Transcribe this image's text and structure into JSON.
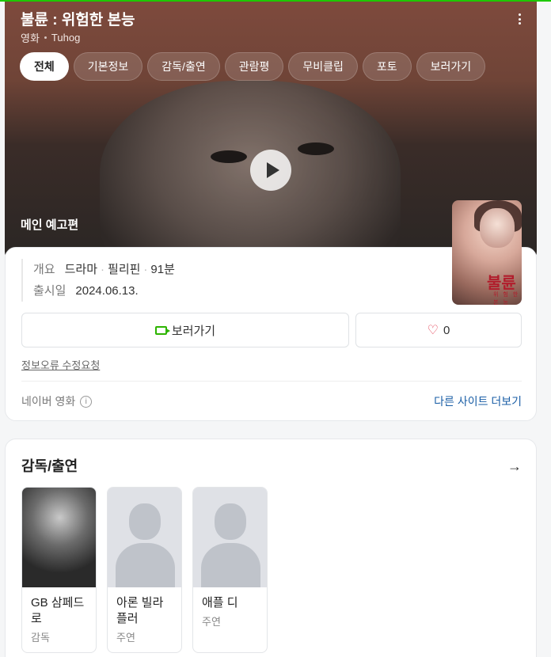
{
  "header": {
    "title": "불륜 : 위험한 본능",
    "category": "영화",
    "subtitle": "Tuhog"
  },
  "tabs": [
    {
      "label": "전체",
      "active": true
    },
    {
      "label": "기본정보"
    },
    {
      "label": "감독/출연"
    },
    {
      "label": "관람평"
    },
    {
      "label": "무비클립"
    },
    {
      "label": "포토"
    },
    {
      "label": "보러가기"
    }
  ],
  "hero": {
    "trailer_label": "메인 예고편"
  },
  "poster": {
    "title": "불륜",
    "subtitle": "위 험 한 본 능"
  },
  "info": {
    "overview_label": "개요",
    "genre": "드라마",
    "country": "필리핀",
    "runtime": "91분",
    "release_label": "출시일",
    "release_date": "2024.06.13."
  },
  "actions": {
    "watch_label": "보러가기",
    "like_count": "0"
  },
  "links": {
    "report": "정보오류 수정요청",
    "source": "네이버 영화",
    "other_sites": "다른 사이트 더보기"
  },
  "cast_section": {
    "title": "감독/출연",
    "people": [
      {
        "name": "GB 삼페드로",
        "role": "감독"
      },
      {
        "name": "아론 빌라플러",
        "role": "주연"
      },
      {
        "name": "애플 디",
        "role": "주연"
      }
    ]
  },
  "colors": {
    "accent_green": "#2db400",
    "link_blue": "#1a5ea6",
    "heart_red": "#e33a4e"
  }
}
